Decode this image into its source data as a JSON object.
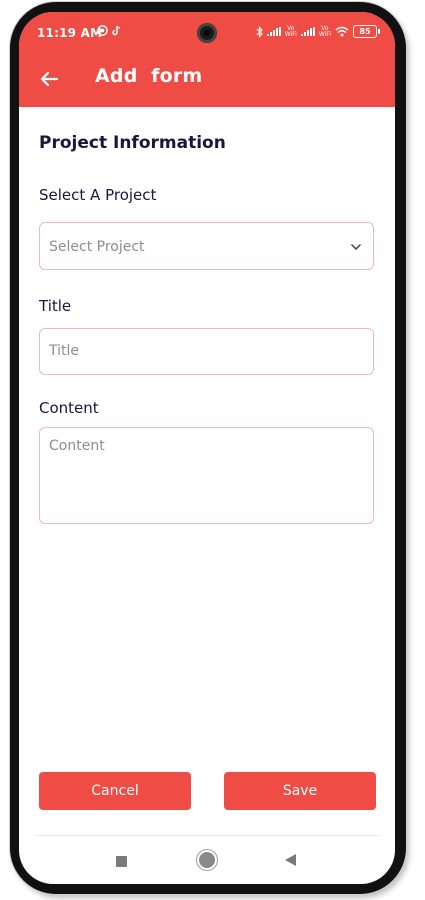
{
  "status_bar": {
    "time": "11:19 AM",
    "battery": "85",
    "vowifi_1": "Vo\nWiFi",
    "vowifi_2": "Vo\nWiFi"
  },
  "appbar": {
    "title": "Add  form",
    "back_icon": "arrow-left-icon",
    "color": "#ef4c45"
  },
  "form": {
    "section_title": "Project Information",
    "project_label": "Select A Project",
    "project_placeholder": "Select Project",
    "title_label": "Title",
    "title_placeholder": "Title",
    "content_label": "Content",
    "content_placeholder": "Content"
  },
  "actions": {
    "cancel_label": "Cancel",
    "save_label": "Save"
  }
}
